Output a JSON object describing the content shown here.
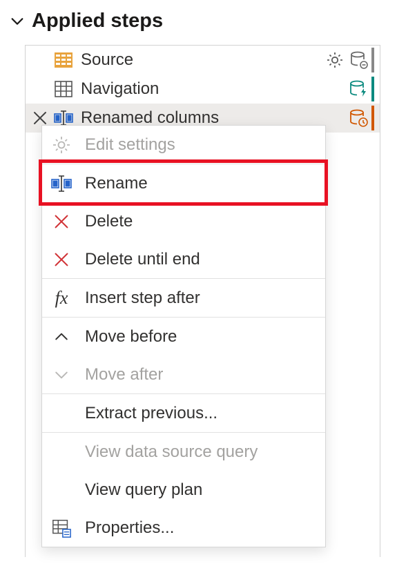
{
  "header": {
    "title": "Applied steps"
  },
  "steps": [
    {
      "label": "Source"
    },
    {
      "label": "Navigation"
    },
    {
      "label": "Renamed columns"
    }
  ],
  "menu": {
    "edit_settings": "Edit settings",
    "rename": "Rename",
    "delete": "Delete",
    "delete_until_end": "Delete until end",
    "insert_step_after": "Insert step after",
    "move_before": "Move before",
    "move_after": "Move after",
    "extract_previous": "Extract previous...",
    "view_data_source_query": "View data source query",
    "view_query_plan": "View query plan",
    "properties": "Properties..."
  }
}
